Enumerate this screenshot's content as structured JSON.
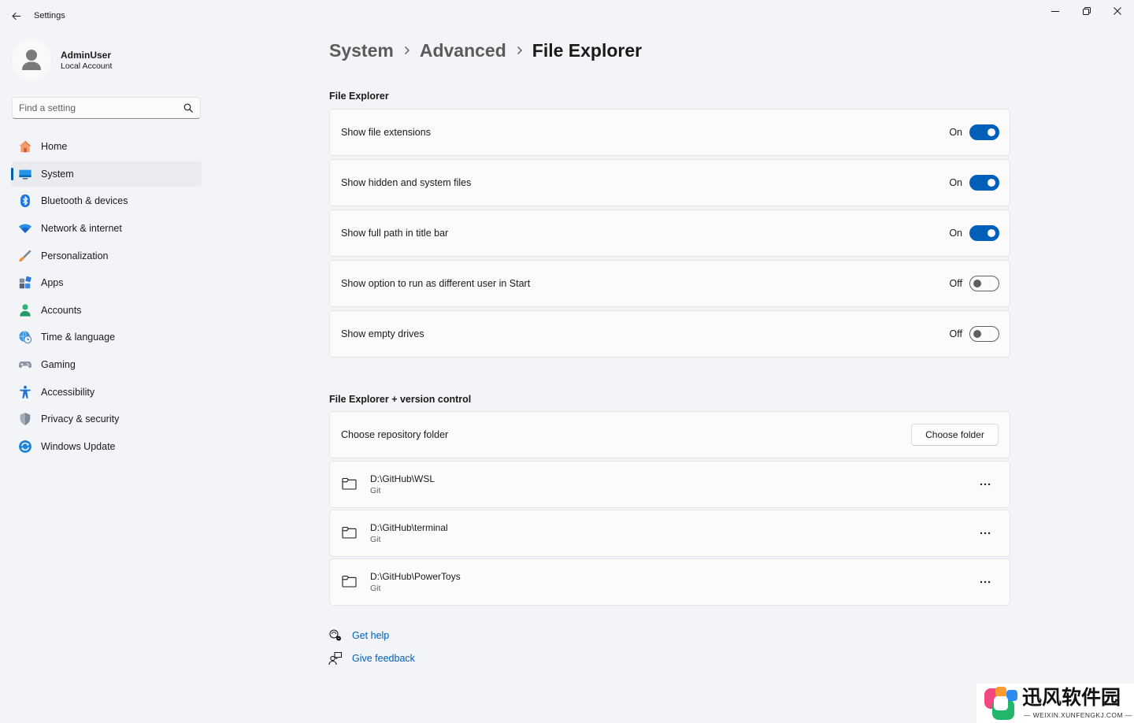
{
  "window": {
    "title": "Settings",
    "controls": [
      "minimize-icon",
      "restore-icon",
      "close-icon"
    ]
  },
  "user": {
    "name": "AdminUser",
    "account_type": "Local Account"
  },
  "search": {
    "placeholder": "Find a setting",
    "value": ""
  },
  "nav": {
    "items": [
      {
        "label": "Home",
        "icon": "home-icon",
        "selected": false
      },
      {
        "label": "System",
        "icon": "monitor-icon",
        "selected": true
      },
      {
        "label": "Bluetooth & devices",
        "icon": "bluetooth-icon",
        "selected": false
      },
      {
        "label": "Network & internet",
        "icon": "wifi-icon",
        "selected": false
      },
      {
        "label": "Personalization",
        "icon": "brush-icon",
        "selected": false
      },
      {
        "label": "Apps",
        "icon": "apps-icon",
        "selected": false
      },
      {
        "label": "Accounts",
        "icon": "account-icon",
        "selected": false
      },
      {
        "label": "Time & language",
        "icon": "globe-clock-icon",
        "selected": false
      },
      {
        "label": "Gaming",
        "icon": "gamepad-icon",
        "selected": false
      },
      {
        "label": "Accessibility",
        "icon": "accessibility-icon",
        "selected": false
      },
      {
        "label": "Privacy & security",
        "icon": "shield-icon",
        "selected": false
      },
      {
        "label": "Windows Update",
        "icon": "update-icon",
        "selected": false
      }
    ]
  },
  "breadcrumb": {
    "items": [
      "System",
      "Advanced",
      "File Explorer"
    ]
  },
  "file_explorer": {
    "heading": "File Explorer",
    "settings": [
      {
        "label": "Show file extensions",
        "state_text": "On",
        "on": true
      },
      {
        "label": "Show hidden and system files",
        "state_text": "On",
        "on": true
      },
      {
        "label": "Show full path in title bar",
        "state_text": "On",
        "on": true
      },
      {
        "label": "Show option to run as different user in Start",
        "state_text": "Off",
        "on": false
      },
      {
        "label": "Show empty drives",
        "state_text": "Off",
        "on": false
      }
    ]
  },
  "version_control": {
    "heading": "File Explorer + version control",
    "repository_folder_label": "Choose repository folder",
    "choose_button": "Choose folder",
    "repositories": [
      {
        "path": "D:\\GitHub\\WSL",
        "type": "Git",
        "icon": "folder-icon"
      },
      {
        "path": "D:\\GitHub\\terminal",
        "type": "Git",
        "icon": "folder-icon"
      },
      {
        "path": "D:\\GitHub\\PowerToys",
        "type": "Git",
        "icon": "folder-icon"
      }
    ]
  },
  "help_links": {
    "get_help": "Get help",
    "give_feedback": "Give feedback"
  },
  "colors": {
    "accent": "#005fb8",
    "background": "#f2f4f8",
    "card": "#fbfbfb",
    "selected_nav": "#e9ebef"
  },
  "watermark": {
    "brand": "迅风软件园",
    "url": "WEIXIN.XUNFENGKJ.COM"
  }
}
